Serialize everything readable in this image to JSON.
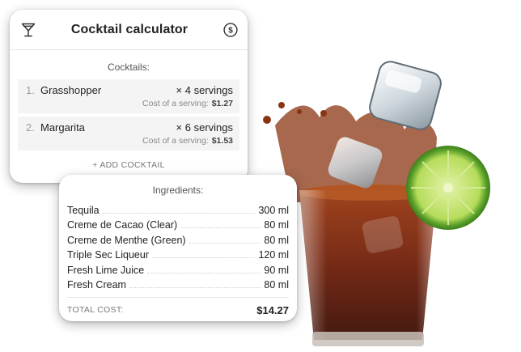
{
  "app": {
    "title": "Cocktail calculator",
    "left_icon": "cocktail-glass-icon",
    "right_icon": "dollar-circle-icon"
  },
  "cocktails": {
    "label": "Cocktails:",
    "items": [
      {
        "num": "1.",
        "name": "Grasshopper",
        "servings": "× 4 servings",
        "cost_label": "Cost of a serving:",
        "cost": "$1.27"
      },
      {
        "num": "2.",
        "name": "Margarita",
        "servings": "× 6 servings",
        "cost_label": "Cost of a serving:",
        "cost": "$1.53"
      }
    ],
    "add_label": "+ ADD COCKTAIL"
  },
  "ingredients": {
    "label": "Ingredients:",
    "items": [
      {
        "name": "Tequila",
        "qty": "300 ml"
      },
      {
        "name": "Creme de Cacao (Clear)",
        "qty": "80 ml"
      },
      {
        "name": "Creme de Menthe (Green)",
        "qty": "80 ml"
      },
      {
        "name": "Triple Sec Liqueur",
        "qty": "120 ml"
      },
      {
        "name": "Fresh Lime Juice",
        "qty": "90 ml"
      },
      {
        "name": "Fresh Cream",
        "qty": "80 ml"
      }
    ],
    "total_label": "TOTAL COST:",
    "total_value": "$14.27"
  },
  "colors": {
    "drink": "#7a2a10",
    "lime": "#7cc243",
    "ice": "#dfe6ea"
  }
}
